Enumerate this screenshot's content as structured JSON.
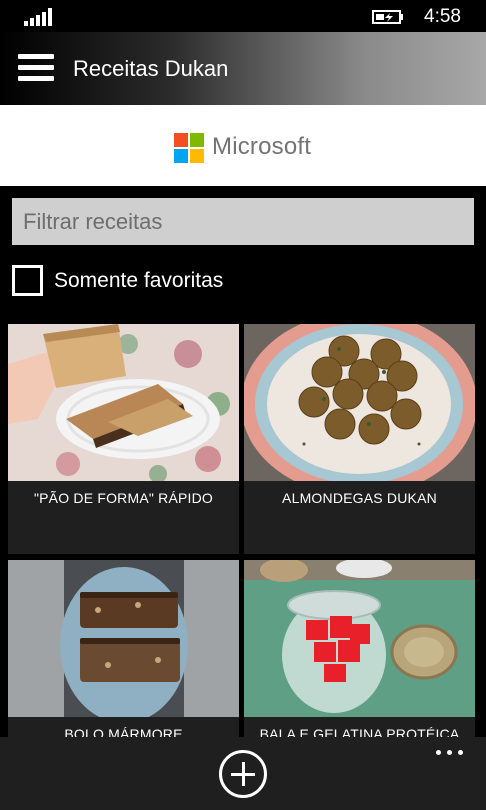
{
  "status_bar": {
    "time": "4:58",
    "signal_icon": "signal-bars-icon",
    "battery_icon": "battery-charging-icon"
  },
  "header": {
    "menu_icon": "hamburger-icon",
    "title": "Receitas Dukan"
  },
  "ad_banner": {
    "brand": "Microsoft",
    "logo_colors": [
      "#f25022",
      "#7fba00",
      "#00a4ef",
      "#ffb900"
    ]
  },
  "filter": {
    "placeholder": "Filtrar receitas",
    "value": ""
  },
  "favorites": {
    "label": "Somente favoritas",
    "checked": false
  },
  "recipes": [
    {
      "title": "\"PÃO DE FORMA\" RÁPIDO"
    },
    {
      "title": "ALMONDEGAS DUKAN"
    },
    {
      "title": "BOLO MÁRMORE"
    },
    {
      "title": "BALA E GELATINA PROTÉICA"
    }
  ],
  "app_bar": {
    "add_icon": "add-circle-icon",
    "more_icon": "ellipsis-icon"
  },
  "colors": {
    "background": "#000000",
    "tile": "#1f1f1f",
    "input": "#cfcfcf"
  }
}
